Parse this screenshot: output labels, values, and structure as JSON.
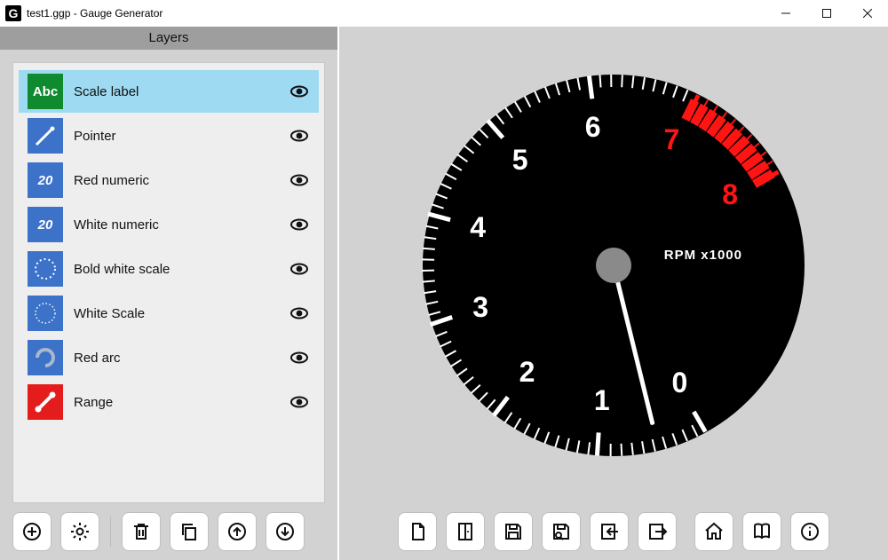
{
  "window": {
    "title": "test1.ggp - Gauge Generator"
  },
  "panels": {
    "layers_header": "Layers"
  },
  "layers": [
    {
      "icon_text": "Abc",
      "label": "Scale label",
      "type": "green",
      "selected": true
    },
    {
      "icon_text": "",
      "label": "Pointer",
      "type": "blue"
    },
    {
      "icon_text": "20",
      "label": "Red numeric",
      "type": "blue"
    },
    {
      "icon_text": "20",
      "label": "White numeric",
      "type": "blue"
    },
    {
      "icon_text": "",
      "label": "Bold white scale",
      "type": "blue"
    },
    {
      "icon_text": "",
      "label": "White Scale",
      "type": "blue"
    },
    {
      "icon_text": "",
      "label": "Red arc",
      "type": "blue"
    },
    {
      "icon_text": "",
      "label": "Range",
      "type": "red"
    }
  ],
  "left_toolbar": {
    "add": "add",
    "settings": "settings",
    "delete": "delete",
    "duplicate": "duplicate",
    "move_up": "move up",
    "move_down": "move down"
  },
  "right_toolbar": {
    "new": "new",
    "open": "open",
    "save": "save",
    "save_as": "save as",
    "import": "import",
    "export": "export",
    "home": "home",
    "manual": "manual",
    "about": "about"
  },
  "gauge": {
    "caption": "RPM x1000",
    "numbers": [
      "0",
      "1",
      "2",
      "3",
      "4",
      "5",
      "6",
      "7",
      "8"
    ]
  }
}
